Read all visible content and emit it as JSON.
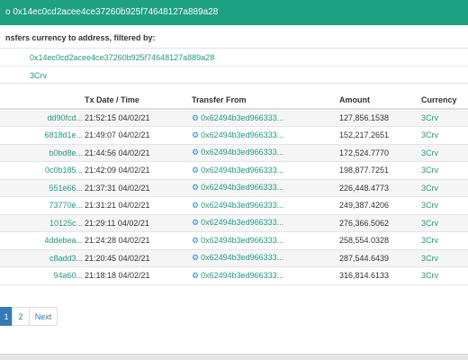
{
  "header": {
    "title": "o 0x14ec0cd2acee4ce37260b925f74648127a889a28"
  },
  "filter": {
    "title": "nsfers currency to address, filtered by:",
    "address": "0x14ec0cd2acee4ce37260b925f74648127a889a28",
    "currency": "3Crv"
  },
  "table": {
    "headers": {
      "date": "Tx Date / Time",
      "from": "Transfer From",
      "amount": "Amount",
      "currency": "Currency"
    },
    "rows": [
      {
        "hash": "dd90fcd...",
        "date": "21:52:15 04/02/21",
        "from": "0x62494b3ed966333...",
        "amount": "127,856.1538",
        "currency": "3Crv"
      },
      {
        "hash": "6818d1e...",
        "date": "21:49:07 04/02/21",
        "from": "0x62494b3ed966333...",
        "amount": "152,217.2651",
        "currency": "3Crv"
      },
      {
        "hash": "b0bd8e...",
        "date": "21:44:56 04/02/21",
        "from": "0x62494b3ed966333...",
        "amount": "172,524.7770",
        "currency": "3Crv"
      },
      {
        "hash": "0c0b185...",
        "date": "21:42:09 04/02/21",
        "from": "0x62494b3ed966333...",
        "amount": "198,877.7251",
        "currency": "3Crv"
      },
      {
        "hash": "551e66...",
        "date": "21:37:31 04/02/21",
        "from": "0x62494b3ed966333...",
        "amount": "226,448.4773",
        "currency": "3Crv"
      },
      {
        "hash": "73770e...",
        "date": "21:31:21 04/02/21",
        "from": "0x62494b3ed966333...",
        "amount": "249,387.4206",
        "currency": "3Crv"
      },
      {
        "hash": "10125c...",
        "date": "21:29:11 04/02/21",
        "from": "0x62494b3ed966333...",
        "amount": "276,366.5062",
        "currency": "3Crv"
      },
      {
        "hash": "4ddebea...",
        "date": "21:24:28 04/02/21",
        "from": "0x62494b3ed966333...",
        "amount": "258,554.0328",
        "currency": "3Crv"
      },
      {
        "hash": "c8add3...",
        "date": "21:20:45 04/02/21",
        "from": "0x62494b3ed966333...",
        "amount": "287,544.6439",
        "currency": "3Crv"
      },
      {
        "hash": "94a60...",
        "date": "21:18:18 04/02/21",
        "from": "0x62494b3ed966333...",
        "amount": "316,814.6133",
        "currency": "3Crv"
      }
    ]
  },
  "pagination": {
    "page1": "1",
    "page2": "2",
    "next": "Next"
  },
  "colors": {
    "accent": "#1ea083",
    "link_blue": "#337ab7",
    "gear_blue": "#2a8fd0"
  },
  "icons": {
    "from_icon": "gear-icon"
  }
}
